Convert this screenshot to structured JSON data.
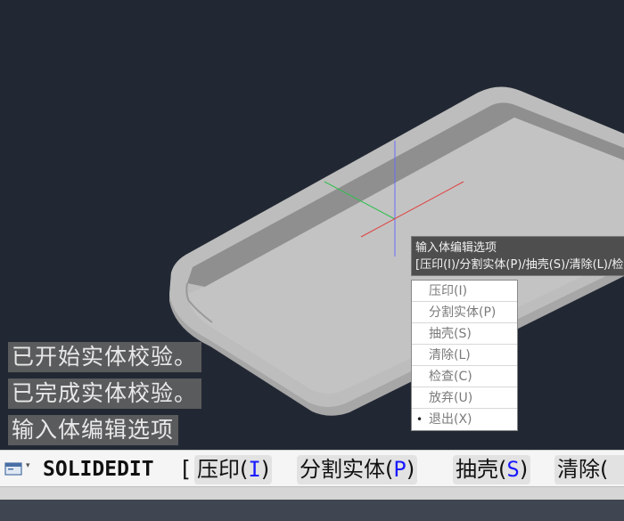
{
  "history": [
    "已开始实体校验。",
    "已完成实体校验。",
    "输入体编辑选项"
  ],
  "tooltip": {
    "title": "输入体编辑选项",
    "options_line": "[压印(I)/分割实体(P)/抽壳(S)/清除(L)/检查(C)/放弃(U)/退出(X)]"
  },
  "menu": {
    "items": [
      {
        "label": "压印(I)",
        "selected": false
      },
      {
        "label": "分割实体(P)",
        "selected": false
      },
      {
        "label": "抽壳(S)",
        "selected": false
      },
      {
        "label": "清除(L)",
        "selected": false
      },
      {
        "label": "检查(C)",
        "selected": false
      },
      {
        "label": "放弃(U)",
        "selected": false
      },
      {
        "label": "退出(X)",
        "selected": true
      }
    ],
    "bullet": "•"
  },
  "command_line": {
    "command": "SOLIDEDIT",
    "bracket": "[",
    "options": [
      {
        "text": "压印(",
        "key": "I",
        "close": ")"
      },
      {
        "text": "分割实体(",
        "key": "P",
        "close": ")"
      },
      {
        "text": "抽壳(",
        "key": "S",
        "close": ")"
      },
      {
        "text": "清除(",
        "key": "",
        "close": ""
      }
    ]
  },
  "colors": {
    "viewport_bg": "#222833",
    "option_key": "#1a1aff"
  },
  "icons": {
    "command_icon": "command-prompt-icon",
    "dropdown": "chevron-down-icon"
  }
}
